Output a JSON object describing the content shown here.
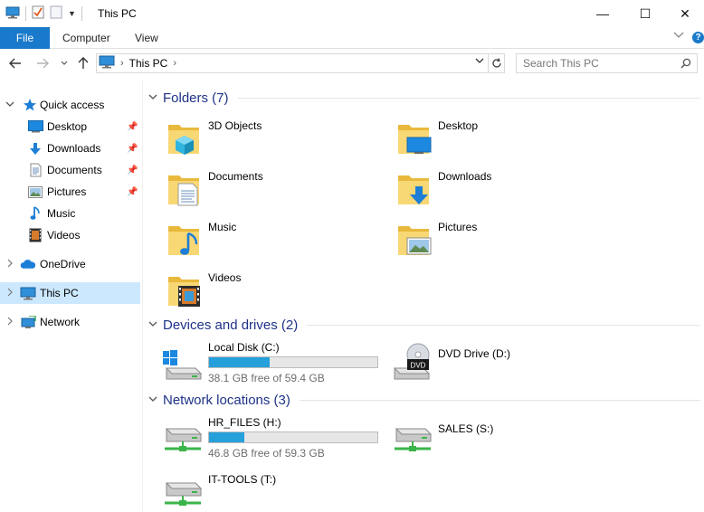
{
  "window": {
    "title": "This PC",
    "controls": {
      "minimize": "—",
      "maximize": "☐",
      "close": "✕"
    }
  },
  "ribbon": {
    "tabs": [
      "File",
      "Computer",
      "View"
    ],
    "help": "?"
  },
  "address": {
    "path": "This PC",
    "search_placeholder": "Search This PC"
  },
  "nav": {
    "quick_access": "Quick access",
    "quick_items": [
      {
        "label": "Desktop",
        "icon": "desktop-icon",
        "pinned": true
      },
      {
        "label": "Downloads",
        "icon": "downloads-icon",
        "pinned": true
      },
      {
        "label": "Documents",
        "icon": "documents-icon",
        "pinned": true
      },
      {
        "label": "Pictures",
        "icon": "pictures-icon",
        "pinned": true
      },
      {
        "label": "Music",
        "icon": "music-icon",
        "pinned": false
      },
      {
        "label": "Videos",
        "icon": "videos-icon",
        "pinned": false
      }
    ],
    "onedrive": "OneDrive",
    "this_pc": "This PC",
    "network": "Network"
  },
  "content": {
    "folders_header": "Folders (7)",
    "folders": [
      {
        "label": "3D Objects",
        "icon": "3d-objects-icon"
      },
      {
        "label": "Desktop",
        "icon": "desktop-icon"
      },
      {
        "label": "Documents",
        "icon": "documents-icon"
      },
      {
        "label": "Downloads",
        "icon": "downloads-icon"
      },
      {
        "label": "Music",
        "icon": "music-icon"
      },
      {
        "label": "Pictures",
        "icon": "pictures-icon"
      },
      {
        "label": "Videos",
        "icon": "videos-icon"
      }
    ],
    "devices_header": "Devices and drives (2)",
    "devices": [
      {
        "label": "Local Disk (C:)",
        "free": "38.1 GB free of 59.4 GB",
        "used_fraction": 0.36
      },
      {
        "label": "DVD Drive (D:)",
        "dvd_text": "DVD"
      }
    ],
    "network_header": "Network locations (3)",
    "network_locations": [
      {
        "label": "HR_FILES (H:)",
        "free": "46.8 GB free of 59.3 GB",
        "used_fraction": 0.21
      },
      {
        "label": "SALES (S:)"
      },
      {
        "label": "IT-TOOLS (T:)"
      }
    ]
  },
  "colors": {
    "accent": "#1979ca",
    "selection": "#cce8ff",
    "group_title": "#1e3287",
    "bar_fill": "#26a0da"
  }
}
